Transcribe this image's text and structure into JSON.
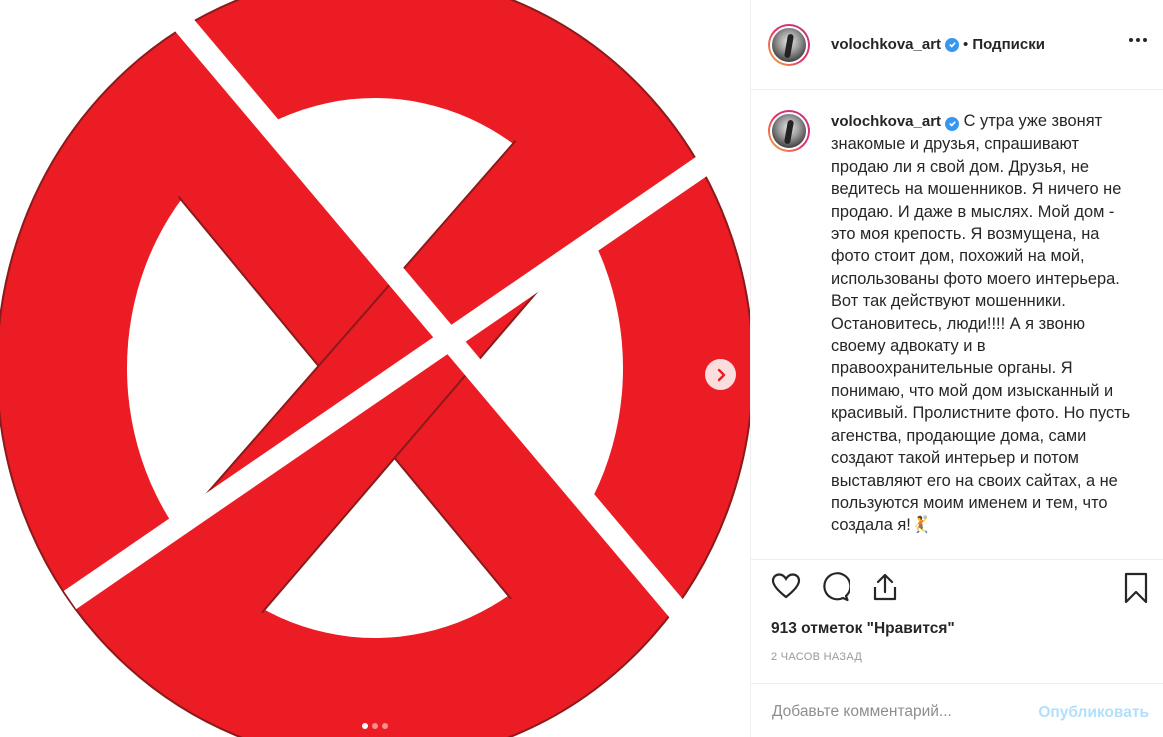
{
  "post": {
    "media_slides": 3,
    "active_slide": 1,
    "image": "red-crossed-circle-prohibition-sign"
  },
  "header": {
    "username": "volochkova_art",
    "separator": "•",
    "follow_label": "Подписки",
    "more_icon": "ellipsis-icon"
  },
  "caption": {
    "username": "volochkova_art",
    "text": "С утра уже звонят знакомые и друзья, спрашивают продаю ли я свой дом. Друзья, не ведитесь на мошенников. Я ничего не продаю. И даже в мыслях. Мой дом - это моя крепость. Я возмущена, на фото стоит дом, похожий на мой, использованы фото моего интерьера. Вот так действуют мошенники. Остановитесь, люди!!!! А я звоню своему адвокату и в правоохранительные органы. Я понимаю, что мой дом изысканный и красивый. Пролистните фото. Но пусть агенства, продающие дома, сами создают такой интерьер и потом выставляют его на своих сайтах, а не пользуются моим именем и тем, что создала я!🤾"
  },
  "stats": {
    "likes": "913 отметок \"Нравится\"",
    "time": "2 ЧАСОВ НАЗАД"
  },
  "comment": {
    "placeholder": "Добавьте комментарий...",
    "publish_label": "Опубликовать"
  },
  "colors": {
    "sign_red": "#ec1c24",
    "verified_blue": "#3897f0",
    "publish_disabled": "#b2dffc"
  }
}
